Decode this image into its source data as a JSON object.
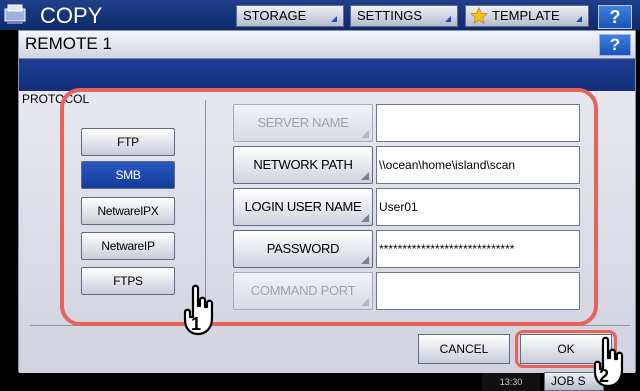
{
  "topbar": {
    "title": "COPY",
    "buttons": [
      {
        "label": "STORAGE"
      },
      {
        "label": "SETTINGS"
      },
      {
        "label": "TEMPLATE"
      }
    ],
    "help_label": "?"
  },
  "dialog": {
    "title": "REMOTE 1",
    "help_label": "?",
    "protocol_label": "PROTOCOL",
    "protocols": [
      {
        "label": "FTP",
        "selected": false
      },
      {
        "label": "SMB",
        "selected": true
      },
      {
        "label": "NetwareIPX",
        "selected": false
      },
      {
        "label": "NetwareIP",
        "selected": false
      },
      {
        "label": "FTPS",
        "selected": false
      }
    ],
    "fields": [
      {
        "label": "SERVER NAME",
        "value": "",
        "enabled": false
      },
      {
        "label": "NETWORK PATH",
        "value": "\\\\ocean\\home\\island\\scan",
        "enabled": true
      },
      {
        "label": "LOGIN USER NAME",
        "value": "User01",
        "enabled": true
      },
      {
        "label": "PASSWORD",
        "value": "*****************************",
        "enabled": true
      },
      {
        "label": "COMMAND PORT",
        "value": "",
        "enabled": false
      }
    ],
    "cancel_label": "CANCEL",
    "ok_label": "OK"
  },
  "status": {
    "time": "13:30",
    "jobs_label": "JOB S"
  },
  "callouts": {
    "step1": "1",
    "step2": "2"
  },
  "colors": {
    "highlight": "#e8625c",
    "selected_button": "#1e4ab0",
    "title_bar_blue": "#1d3f96"
  }
}
